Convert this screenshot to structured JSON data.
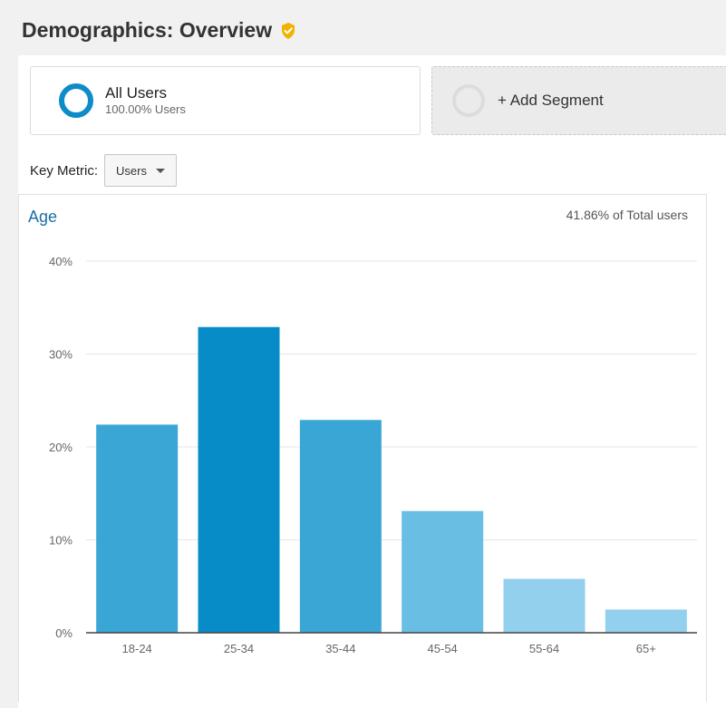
{
  "header": {
    "title": "Demographics: Overview",
    "verified_icon": "shield-check-icon"
  },
  "segments": {
    "active": {
      "name": "All Users",
      "percent": "100.00% Users",
      "icon": "donut-icon",
      "color": "#0e8cc8"
    },
    "add": {
      "label": "+ Add Segment",
      "icon": "empty-circle-icon"
    }
  },
  "key_metric": {
    "label": "Key Metric:",
    "selected": "Users"
  },
  "chart_panel": {
    "title": "Age",
    "summary": "41.86% of Total users"
  },
  "chart_data": {
    "type": "bar",
    "title": "Age",
    "categories": [
      "18-24",
      "25-34",
      "35-44",
      "45-54",
      "55-64",
      "65+"
    ],
    "values": [
      22.4,
      32.9,
      22.9,
      13.1,
      5.8,
      2.5
    ],
    "colors": [
      "#3aa6d6",
      "#078cc7",
      "#3aa6d6",
      "#69bee3",
      "#93d0ee",
      "#93d0ee"
    ],
    "ylim": [
      0,
      40
    ],
    "yticks": [
      "0%",
      "10%",
      "20%",
      "30%",
      "40%"
    ],
    "ytick_values": [
      0,
      10,
      20,
      30,
      40
    ],
    "grid": true
  }
}
